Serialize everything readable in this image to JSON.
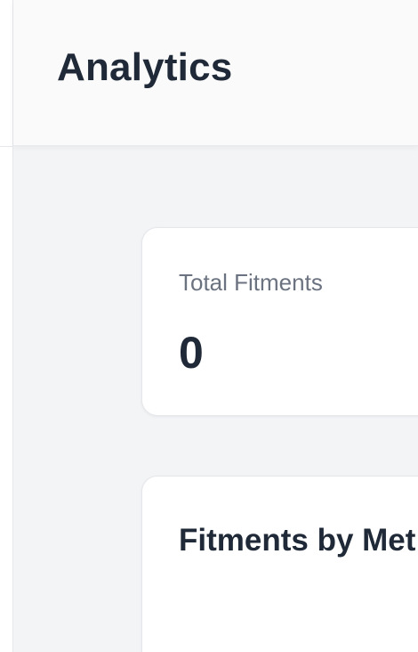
{
  "header": {
    "title": "Analytics"
  },
  "stats": {
    "total_fitments_label": "Total Fitments",
    "total_fitments_value": "0"
  },
  "chart_section": {
    "title": "Fitments by Met"
  },
  "colors": {
    "page_background": "#f3f4f6",
    "card_background": "#ffffff",
    "title_text": "#1f2937",
    "muted_text": "#6b7280"
  }
}
